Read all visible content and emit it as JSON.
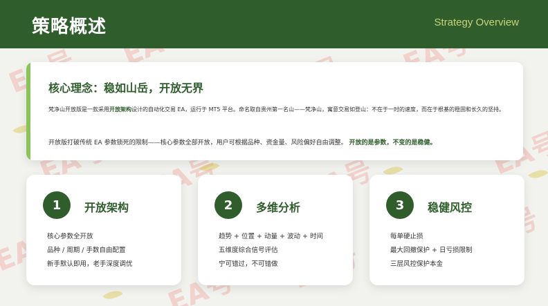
{
  "header": {
    "title": "策略概述",
    "subtitle": "Strategy Overview"
  },
  "watermark": "EA号",
  "colors": {
    "header_bg": "#2f5e2c",
    "accent_green": "#8cc25a",
    "subtitle": "#c8d37a",
    "page_bg": "#f2f3ef"
  },
  "core": {
    "title": "核心理念：稳如山岳，开放无界",
    "para1_a": "梵净山开放版是一款采用",
    "para1_hl": "开放架构",
    "para1_b": "设计的自动化交易 EA，运行于 MT5 平台。命名取自贵州第一名山——梵净山，寓意交易如登山：不在于一时的速度，而在于根基的稳固和长久的坚持。",
    "para2_a": "开放版打破传统 EA 参数锁死的限制——核心参数全部开放，用户可根据品种、资金量、风险偏好自由调整。",
    "para2_hl": "开放的是参数，不变的是稳健。"
  },
  "features": [
    {
      "number": "1",
      "title": "开放架构",
      "items": [
        "核心参数全开放",
        "品种 / 周期 / 手数自由配置",
        "新手默认即用，老手深度调优"
      ]
    },
    {
      "number": "2",
      "title": "多维分析",
      "items": [
        "趋势 + 位置 + 动量 + 波动 + 时间",
        "五维度综合信号评估",
        "宁可错过，不可错做"
      ]
    },
    {
      "number": "3",
      "title": "稳健风控",
      "items": [
        "每单硬止损",
        "最大回撤保护 + 日亏损限制",
        "三层风控保护本金"
      ]
    }
  ]
}
